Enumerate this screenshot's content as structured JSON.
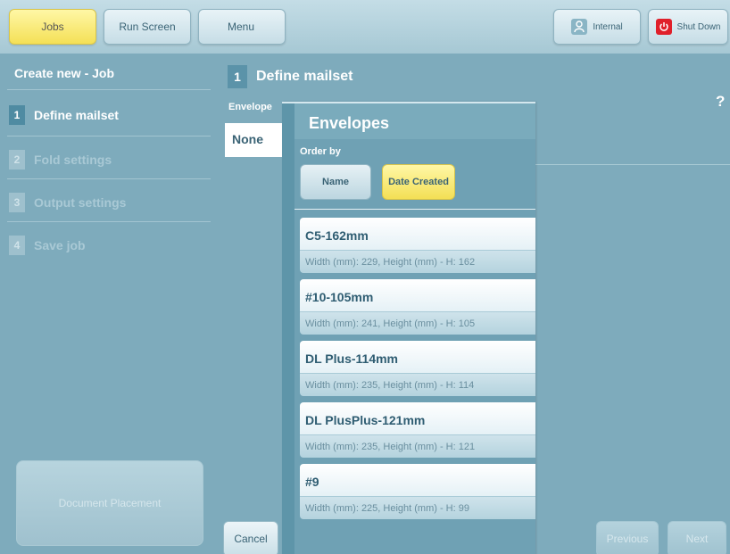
{
  "topbar": {
    "jobs": "Jobs",
    "run_screen": "Run Screen",
    "menu": "Menu",
    "internal": "Internal",
    "shut_down": "Shut Down"
  },
  "sidebar": {
    "title": "Create new - Job",
    "steps": [
      {
        "num": "1",
        "label": "Define mailset"
      },
      {
        "num": "2",
        "label": "Fold settings"
      },
      {
        "num": "3",
        "label": "Output settings"
      },
      {
        "num": "4",
        "label": "Save job"
      }
    ],
    "document_placement": "Document Placement"
  },
  "breadcrumb": {
    "num": "1",
    "title": "Define mailset"
  },
  "help": "?",
  "envelope_column": {
    "label": "Envelope",
    "value": "None"
  },
  "envelopes_panel": {
    "title": "Envelopes",
    "order_by_label": "Order by",
    "order_name": "Name",
    "order_date": "Date Created",
    "items": [
      {
        "name": "C5-162mm",
        "desc": "Width (mm): 229, Height (mm) - H: 162"
      },
      {
        "name": "#10-105mm",
        "desc": "Width (mm): 241, Height (mm) - H: 105"
      },
      {
        "name": "DL Plus-114mm",
        "desc": "Width (mm): 235, Height (mm) - H: 114"
      },
      {
        "name": "DL PlusPlus-121mm",
        "desc": "Width (mm): 235, Height (mm) - H: 121"
      },
      {
        "name": "#9",
        "desc": "Width (mm): 225, Height (mm) - H: 99"
      }
    ]
  },
  "footer": {
    "cancel": "Cancel",
    "previous": "Previous",
    "next": "Next"
  },
  "colors": {
    "background": "#7eabbc",
    "active_yellow": "#f4e056",
    "shutdown_red": "#e0202a"
  },
  "icons": {
    "internal": "person-icon",
    "shut_down": "power-icon",
    "help": "help-icon"
  }
}
